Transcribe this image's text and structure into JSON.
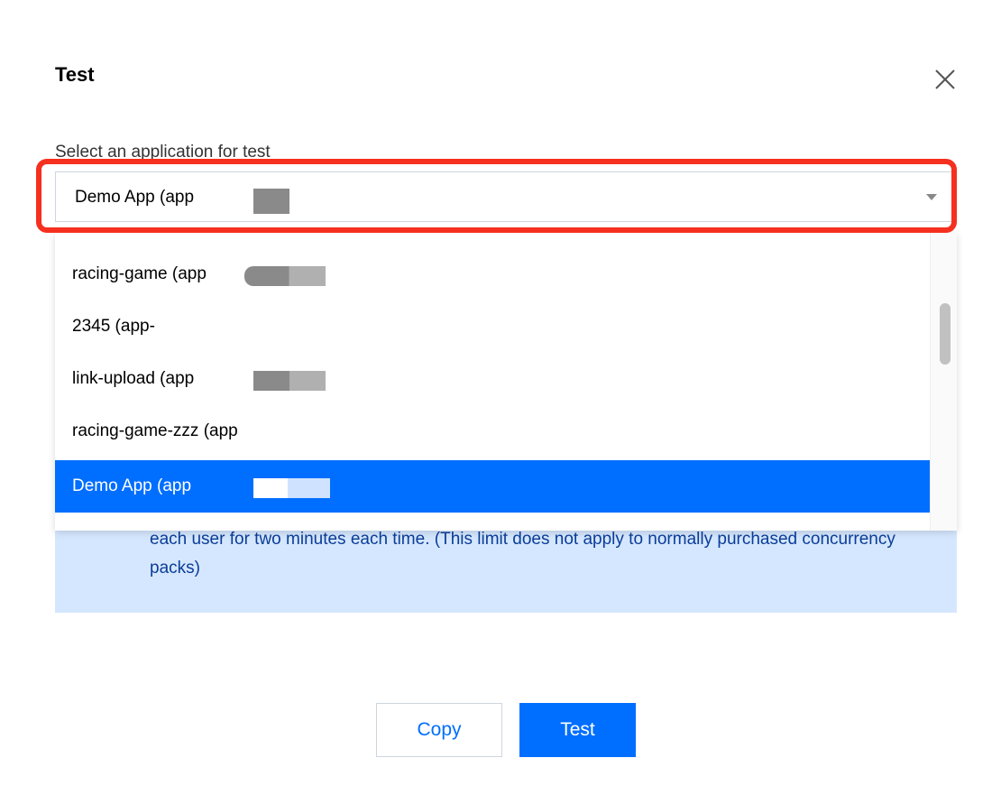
{
  "dialog": {
    "title": "Test",
    "close_icon": "close-icon"
  },
  "field": {
    "label": "Select an application for test",
    "selected_value": "Demo App (app"
  },
  "dropdown": {
    "options": [
      {
        "label": "racing-game (app"
      },
      {
        "label": "2345 (app-"
      },
      {
        "label": "link-upload (app"
      },
      {
        "label": "racing-game-zzz (app"
      },
      {
        "label": "Demo App (app",
        "selected": true
      }
    ]
  },
  "notice": {
    "text": "each user for two minutes each time. (This limit does not apply to normally purchased concurrency packs)"
  },
  "footer": {
    "copy_label": "Copy",
    "test_label": "Test"
  },
  "colors": {
    "accent": "#006eff",
    "highlight": "#f5301e",
    "notice_bg": "#d5e7fe",
    "notice_text": "#0b3d99"
  }
}
